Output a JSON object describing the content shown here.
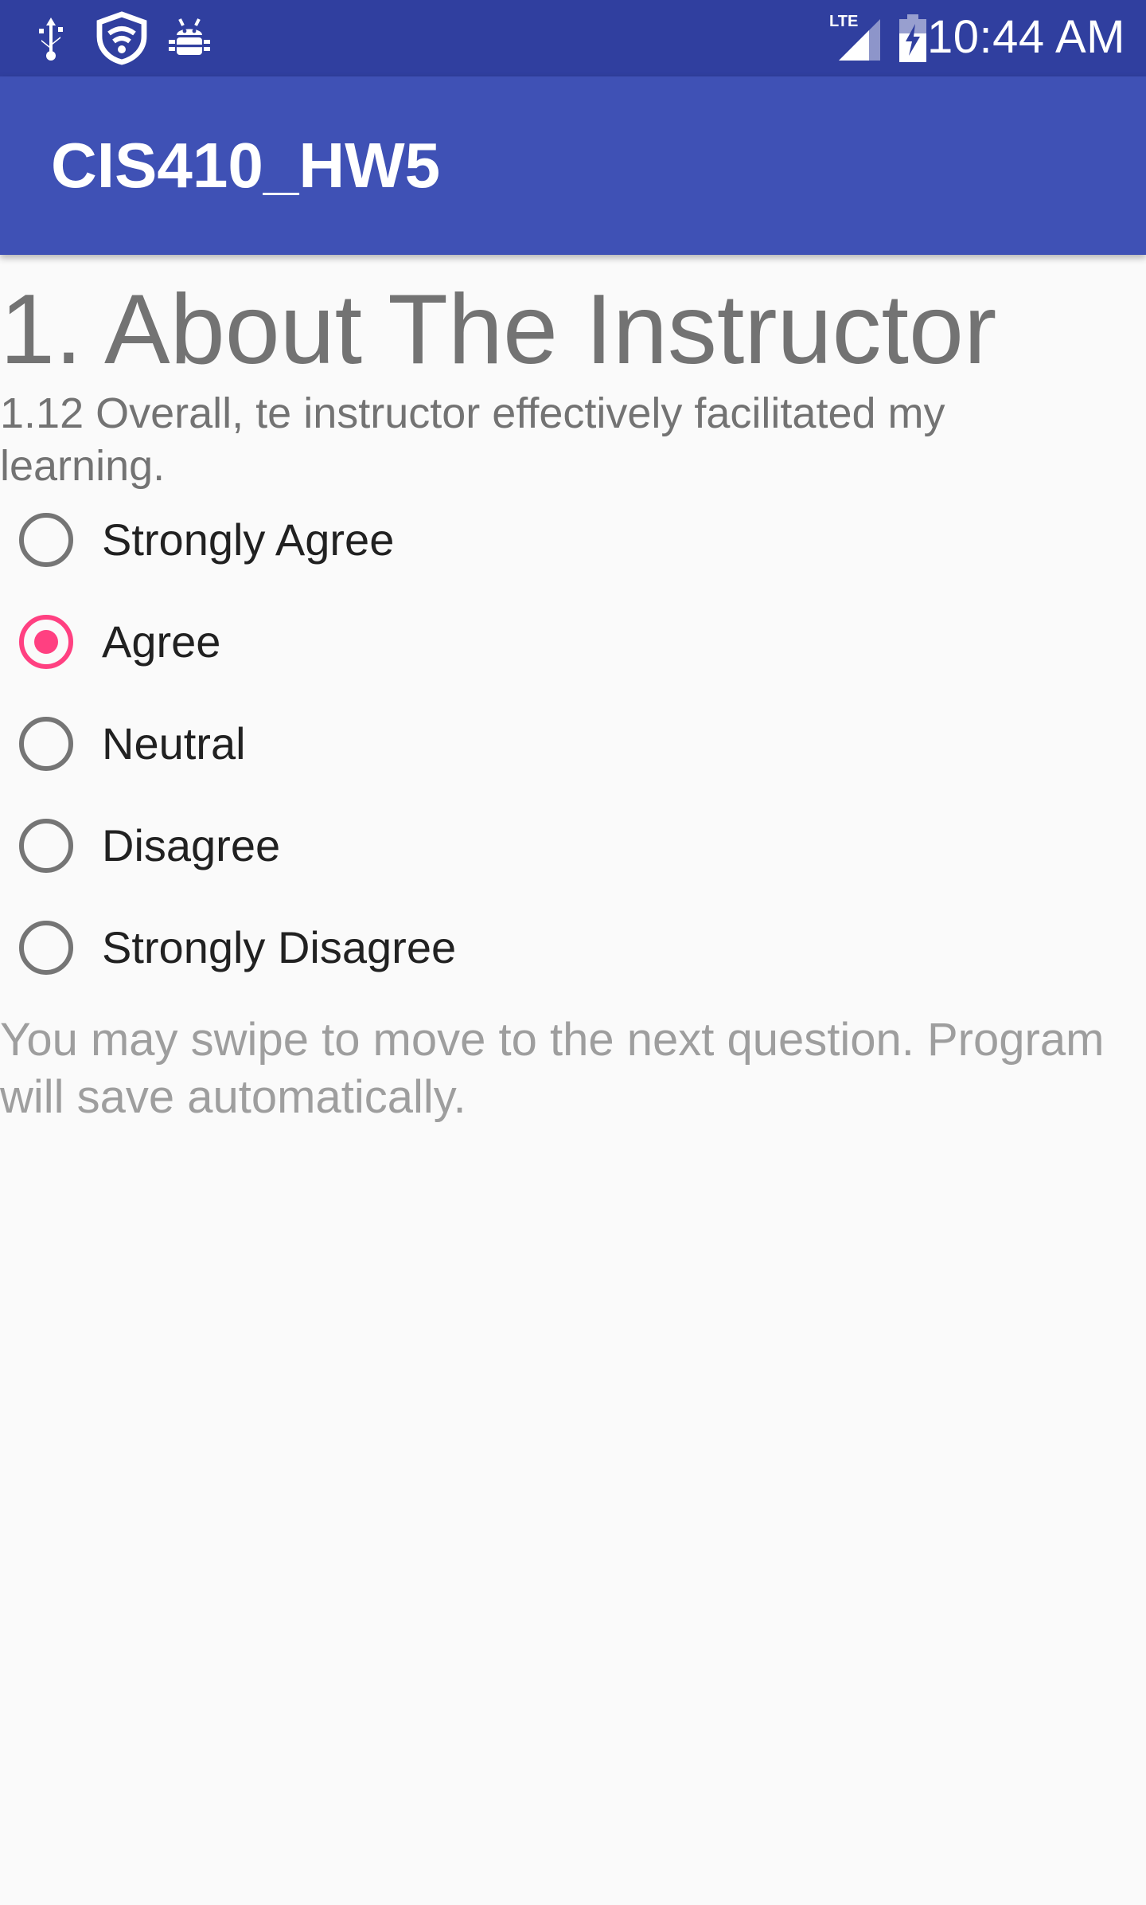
{
  "status_bar": {
    "time": "10:44 AM",
    "network_label": "LTE",
    "left_icons": [
      "usb-icon",
      "security-shield-icon",
      "android-debug-icon"
    ],
    "right_icons": [
      "signal-icon",
      "battery-charging-icon"
    ]
  },
  "app_bar": {
    "title": "CIS410_HW5"
  },
  "survey": {
    "section_title": "1. About The Instructor",
    "question": "1.12 Overall, te instructor effectively facilitated my learning.",
    "options": [
      {
        "label": "Strongly Agree",
        "checked": false
      },
      {
        "label": "Agree",
        "checked": true
      },
      {
        "label": "Neutral",
        "checked": false
      },
      {
        "label": "Disagree",
        "checked": false
      },
      {
        "label": "Strongly Disagree",
        "checked": false
      }
    ],
    "hint": "You may swipe to move to the next question. Program will save automatically."
  },
  "colors": {
    "status_bar": "#303f9f",
    "app_bar": "#3f51b5",
    "accent": "#ff4081",
    "background": "#fafafa"
  }
}
